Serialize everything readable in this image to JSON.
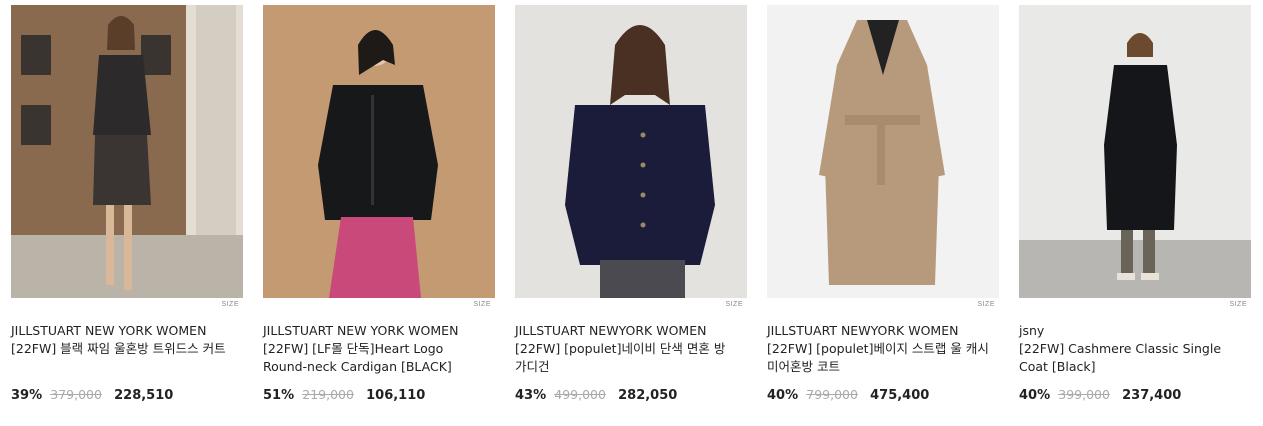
{
  "products": [
    {
      "brand": "JILLSTUART NEW YORK WOMEN",
      "name": "[22FW] 블랙 짜임 울혼방 트위드스 커트",
      "discount": "39%",
      "original_price": "379,000",
      "sale_price": "228,510",
      "size_label": "SIZE",
      "image_desc": "woman-in-tweed-skirt-street-photo"
    },
    {
      "brand": "JILLSTUART NEW YORK WOMEN",
      "name": "[22FW] [LF몰 단독]Heart Logo Round-neck Cardigan [BLACK]",
      "discount": "51%",
      "original_price": "219,000",
      "sale_price": "106,110",
      "size_label": "SIZE",
      "image_desc": "woman-in-black-cardigan-pink-pants"
    },
    {
      "brand": "JILLSTUART NEWYORK WOMEN",
      "name": "[22FW] [populet]네이비 단색 면혼 방 가디건",
      "discount": "43%",
      "original_price": "499,000",
      "sale_price": "282,050",
      "size_label": "SIZE",
      "image_desc": "woman-in-navy-cardigan"
    },
    {
      "brand": "JILLSTUART NEWYORK WOMEN",
      "name": "[22FW] [populet]베이지 스트랩 울 캐시미어혼방 코트",
      "discount": "40%",
      "original_price": "799,000",
      "sale_price": "475,400",
      "size_label": "SIZE",
      "image_desc": "beige-belted-wool-coat"
    },
    {
      "brand": "jsny",
      "name": "[22FW] Cashmere Classic Single Coat [Black]",
      "discount": "40%",
      "original_price": "399,000",
      "sale_price": "237,400",
      "size_label": "SIZE",
      "image_desc": "woman-in-long-black-coat"
    }
  ],
  "colors": {
    "text": "#222222",
    "strike": "#aaaaaa"
  }
}
